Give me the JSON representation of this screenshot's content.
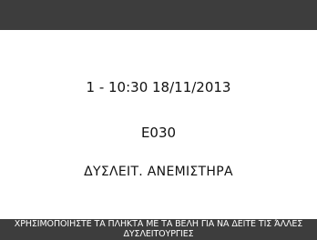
{
  "status": {
    "timestamp": "1 - 10:30 18/11/2013",
    "error_code": "E030",
    "error_description": "ΔΥΣΛΕΙΤ. ΑΝΕΜΙΣΤΗΡΑ"
  },
  "footer": {
    "hint": "ΧΡΗΣΙΜΟΠΟΙΗΣΤΕ ΤΑ ΠΛΗΚΤΑ ΜΕ ΤΑ ΒΕΛΗ ΓΙΑ ΝΑ ΔΕΙΤΕ ΤΙΣ ΆΛΛΕΣ ΔΥΣΛΕΙΤΟΥΡΓΙΕΣ"
  },
  "colors": {
    "bar": "#3d3d3d",
    "background": "#ffffff",
    "text": "#111111",
    "bar_text": "#ffffff"
  }
}
